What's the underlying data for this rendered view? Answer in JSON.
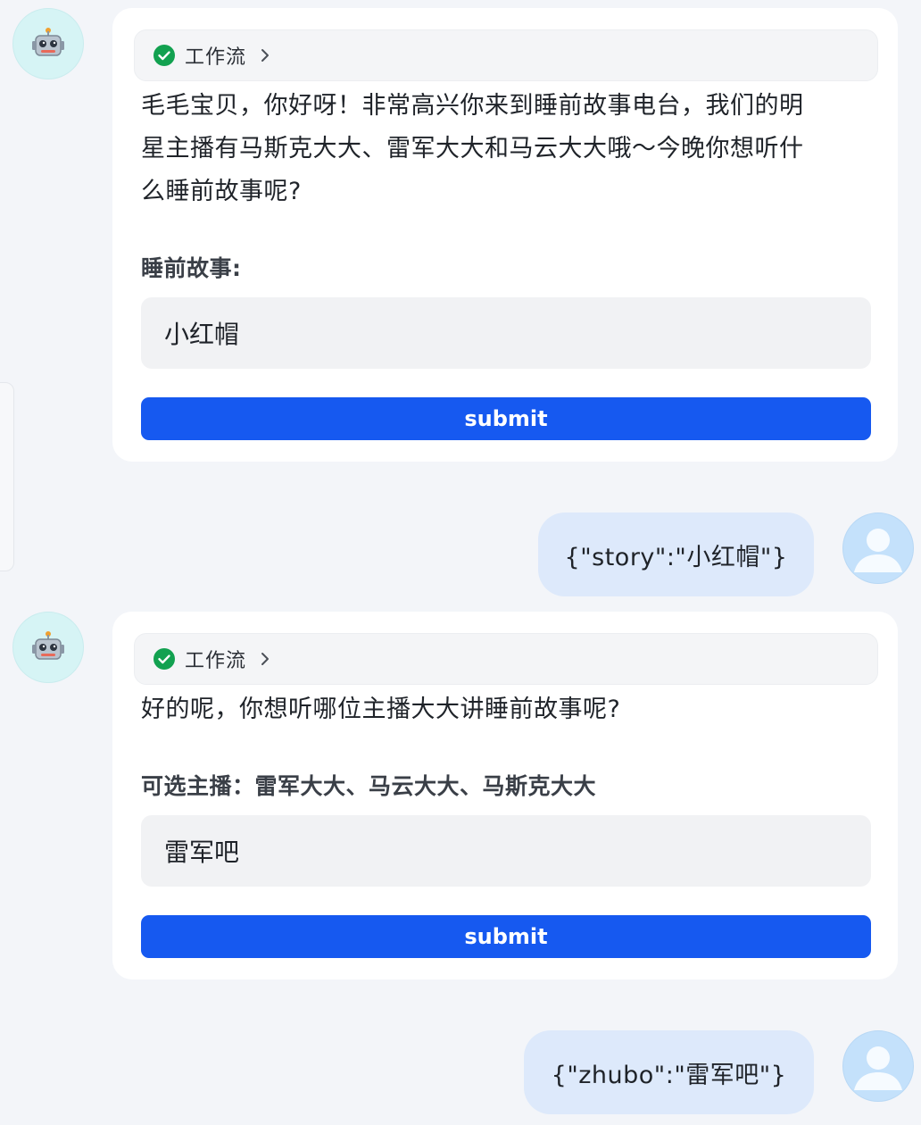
{
  "messages": [
    {
      "role": "bot",
      "workflow_label": "工作流",
      "text_lines": [
        "毛毛宝贝，你好呀！非常高兴你来到睡前故事电台，我们的明",
        "星主播有马斯克大大、雷军大大和马云大大哦～今晚你想听什",
        "么睡前故事呢?"
      ],
      "field_label": "睡前故事:",
      "field_value": "小红帽",
      "submit_label": "submit"
    },
    {
      "role": "user",
      "text": "{\"story\":\"小红帽\"}"
    },
    {
      "role": "bot",
      "workflow_label": "工作流",
      "text_lines": [
        "好的呢，你想听哪位主播大大讲睡前故事呢?"
      ],
      "field_label": "可选主播：雷军大大、马云大大、马斯克大大",
      "field_value": "雷军吧",
      "submit_label": "submit"
    },
    {
      "role": "user",
      "text": "{\"zhubo\":\"雷军吧\"}"
    }
  ],
  "icons": {
    "bot_avatar": "robot-icon",
    "user_avatar": "user-icon",
    "workflow_status": "check-circle-icon",
    "workflow_expand": "chevron-right-icon"
  },
  "colors": {
    "accent": "#1659f0",
    "success": "#12a150",
    "user_bubble": "#dde9fb",
    "background": "#f3f5f9"
  }
}
